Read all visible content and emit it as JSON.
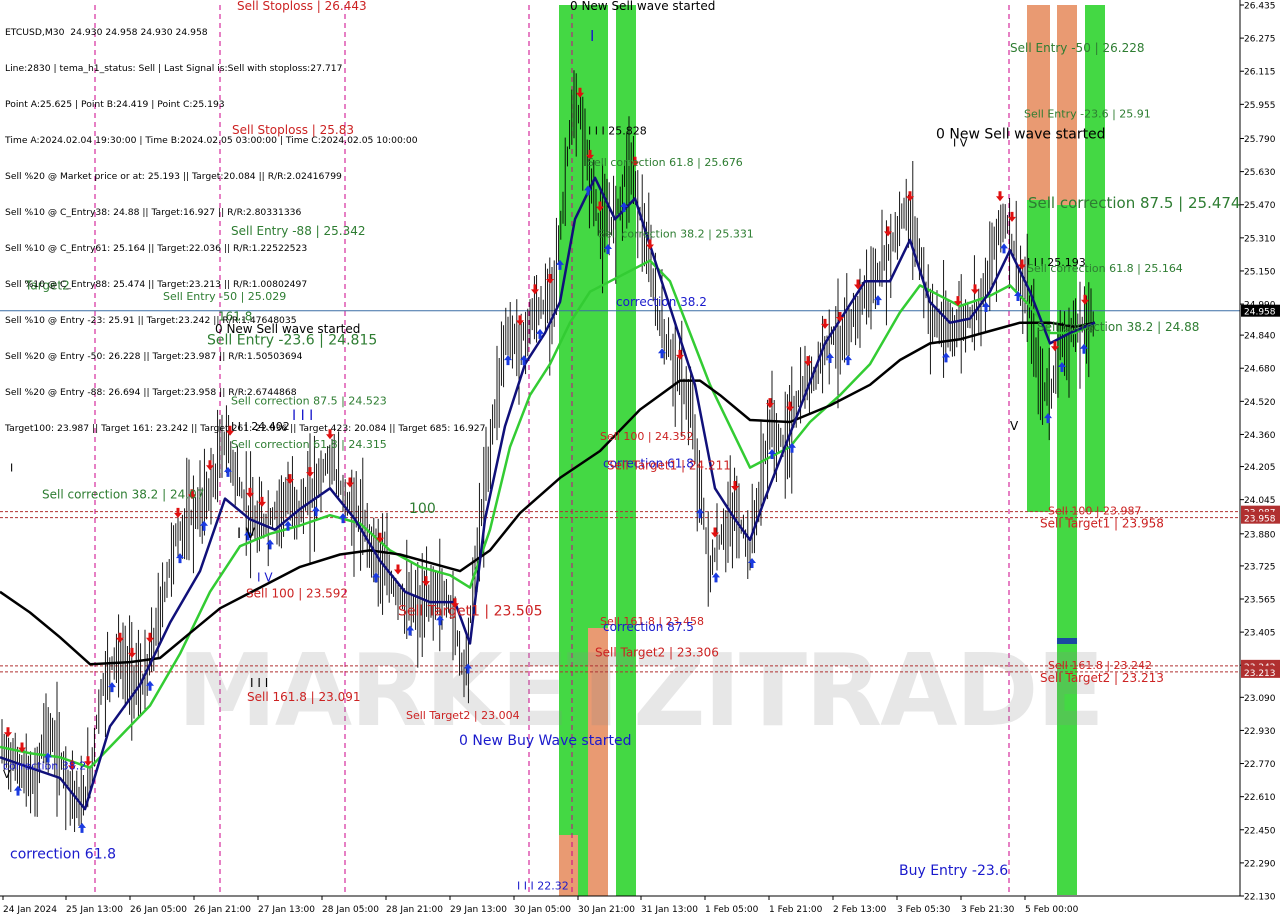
{
  "header": {
    "symbol_line": "ETCUSD,M30  24.930 24.958 24.930 24.958",
    "lines": [
      "Line:2830 | tema_h1_status: Sell | Last Signal is:Sell with stoploss:27.717",
      "Point A:25.625 | Point B:24.419 | Point C:25.193",
      "Time A:2024.02.04 19:30:00 | Time B:2024.02.05 03:00:00 | Time C:2024.02.05 10:00:00",
      "Sell %20 @ Market price or at: 25.193 || Target:20.084 || R/R:2.02416799",
      "Sell %10 @ C_Entry38: 24.88 || Target:16.927 || R/R:2.80331336",
      "Sell %10 @ C_Entry61: 25.164 || Target:22.036 || R/R:1.22522523",
      "Sell %10 @ C_Entry88: 25.474 || Target:23.213 || R/R:1.00802497",
      "Sell %10 @ Entry -23: 25.91 || Target:23.242 || R/R:1.47648035",
      "Sell %20 @ Entry -50: 26.228 || Target:23.987 || R/R:1.50503694",
      "Sell %20 @ Entry -88: 26.694 || Target:23.958 || R/R:2.6744868",
      "Target100: 23.987 || Target 161: 23.242 || Target 261: 22.036 || Target 423: 20.084 || Target 685: 16.927"
    ]
  },
  "colors": {
    "red": "#cc2222",
    "green_text": "#2e7d32",
    "blue_text": "#1a1acc",
    "zone_green": "#3ad63a",
    "zone_orange": "#e8956a",
    "ma_green": "#33cc33",
    "ma_navy": "#10107a",
    "ma_black": "#000000",
    "hline": "#3b6ea5",
    "red_dash": "#b03030",
    "magenta_dash": "#cc0088"
  },
  "chart_data": {
    "type": "candlestick",
    "symbol": "ETCUSD",
    "timeframe": "M30",
    "ylim": [
      22.13,
      26.435
    ],
    "current_price": 24.958,
    "y_ticks": [
      "26.435",
      "26.275",
      "26.115",
      "25.955",
      "25.790",
      "25.630",
      "25.470",
      "25.310",
      "25.150",
      "24.990",
      "24.840",
      "24.680",
      "24.520",
      "24.360",
      "24.205",
      "24.045",
      "23.880",
      "23.725",
      "23.565",
      "23.405",
      "23.245",
      "23.090",
      "22.930",
      "22.770",
      "22.610",
      "22.450",
      "22.290",
      "22.130"
    ],
    "x_labels": [
      "24 Jan 2024",
      "25 Jan 13:00",
      "26 Jan 05:00",
      "26 Jan 21:00",
      "27 Jan 13:00",
      "28 Jan 05:00",
      "28 Jan 21:00",
      "29 Jan 13:00",
      "30 Jan 05:00",
      "30 Jan 21:00",
      "31 Jan 13:00",
      "1 Feb 05:00",
      "1 Feb 21:00",
      "2 Feb 13:00",
      "3 Feb 05:30",
      "3 Feb 21:30",
      "5 Feb 00:00"
    ],
    "price_path": [
      [
        0,
        22.85
      ],
      [
        20,
        22.75
      ],
      [
        35,
        22.65
      ],
      [
        45,
        22.95
      ],
      [
        60,
        22.8
      ],
      [
        80,
        22.55
      ],
      [
        90,
        22.7
      ],
      [
        100,
        23.1
      ],
      [
        115,
        23.3
      ],
      [
        130,
        23.2
      ],
      [
        145,
        23.15
      ],
      [
        160,
        23.5
      ],
      [
        175,
        23.85
      ],
      [
        190,
        23.95
      ],
      [
        200,
        24.0
      ],
      [
        215,
        24.15
      ],
      [
        225,
        24.35
      ],
      [
        240,
        24.1
      ],
      [
        255,
        23.9
      ],
      [
        270,
        23.95
      ],
      [
        285,
        24.05
      ],
      [
        300,
        24.0
      ],
      [
        315,
        24.1
      ],
      [
        330,
        24.25
      ],
      [
        345,
        24.05
      ],
      [
        360,
        23.95
      ],
      [
        375,
        23.8
      ],
      [
        390,
        23.65
      ],
      [
        405,
        23.55
      ],
      [
        420,
        23.5
      ],
      [
        435,
        23.6
      ],
      [
        450,
        23.55
      ],
      [
        465,
        23.2
      ],
      [
        475,
        23.7
      ],
      [
        490,
        24.3
      ],
      [
        505,
        24.85
      ],
      [
        520,
        24.8
      ],
      [
        535,
        24.95
      ],
      [
        550,
        25.0
      ],
      [
        560,
        25.3
      ],
      [
        570,
        25.85
      ],
      [
        580,
        25.9
      ],
      [
        590,
        25.6
      ],
      [
        600,
        25.35
      ],
      [
        615,
        25.4
      ],
      [
        630,
        25.7
      ],
      [
        645,
        25.3
      ],
      [
        660,
        24.9
      ],
      [
        675,
        24.7
      ],
      [
        690,
        24.5
      ],
      [
        700,
        24.1
      ],
      [
        710,
        23.7
      ],
      [
        720,
        23.85
      ],
      [
        735,
        24.0
      ],
      [
        750,
        23.8
      ],
      [
        760,
        24.1
      ],
      [
        770,
        24.4
      ],
      [
        785,
        24.3
      ],
      [
        800,
        24.55
      ],
      [
        815,
        24.65
      ],
      [
        830,
        24.85
      ],
      [
        845,
        24.8
      ],
      [
        860,
        25.0
      ],
      [
        875,
        25.1
      ],
      [
        890,
        25.25
      ],
      [
        905,
        25.45
      ],
      [
        915,
        25.35
      ],
      [
        930,
        24.95
      ],
      [
        945,
        24.85
      ],
      [
        960,
        24.9
      ],
      [
        975,
        24.95
      ],
      [
        990,
        25.15
      ],
      [
        1000,
        25.4
      ],
      [
        1010,
        25.35
      ],
      [
        1020,
        25.1
      ],
      [
        1030,
        24.95
      ],
      [
        1040,
        24.6
      ],
      [
        1050,
        24.55
      ],
      [
        1060,
        24.8
      ],
      [
        1075,
        24.85
      ],
      [
        1085,
        24.9
      ],
      [
        1095,
        24.93
      ]
    ],
    "ma_black": [
      [
        0,
        23.6
      ],
      [
        30,
        23.5
      ],
      [
        60,
        23.38
      ],
      [
        90,
        23.25
      ],
      [
        130,
        23.26
      ],
      [
        160,
        23.28
      ],
      [
        190,
        23.4
      ],
      [
        220,
        23.52
      ],
      [
        260,
        23.62
      ],
      [
        300,
        23.72
      ],
      [
        340,
        23.78
      ],
      [
        370,
        23.8
      ],
      [
        400,
        23.78
      ],
      [
        430,
        23.74
      ],
      [
        460,
        23.7
      ],
      [
        490,
        23.8
      ],
      [
        520,
        23.98
      ],
      [
        560,
        24.15
      ],
      [
        600,
        24.28
      ],
      [
        640,
        24.48
      ],
      [
        680,
        24.62
      ],
      [
        700,
        24.62
      ],
      [
        720,
        24.55
      ],
      [
        750,
        24.43
      ],
      [
        790,
        24.42
      ],
      [
        830,
        24.5
      ],
      [
        870,
        24.6
      ],
      [
        900,
        24.72
      ],
      [
        930,
        24.8
      ],
      [
        960,
        24.82
      ],
      [
        990,
        24.86
      ],
      [
        1020,
        24.9
      ],
      [
        1050,
        24.9
      ],
      [
        1075,
        24.88
      ],
      [
        1095,
        24.9
      ]
    ],
    "ma_green": [
      [
        0,
        22.85
      ],
      [
        30,
        22.82
      ],
      [
        60,
        22.8
      ],
      [
        90,
        22.75
      ],
      [
        120,
        22.9
      ],
      [
        150,
        23.05
      ],
      [
        180,
        23.3
      ],
      [
        210,
        23.6
      ],
      [
        240,
        23.82
      ],
      [
        270,
        23.88
      ],
      [
        300,
        23.92
      ],
      [
        330,
        23.97
      ],
      [
        360,
        23.93
      ],
      [
        390,
        23.8
      ],
      [
        420,
        23.72
      ],
      [
        450,
        23.68
      ],
      [
        470,
        23.62
      ],
      [
        490,
        23.9
      ],
      [
        510,
        24.3
      ],
      [
        530,
        24.55
      ],
      [
        550,
        24.7
      ],
      [
        570,
        24.9
      ],
      [
        590,
        25.05
      ],
      [
        610,
        25.1
      ],
      [
        630,
        25.15
      ],
      [
        650,
        25.2
      ],
      [
        670,
        25.1
      ],
      [
        690,
        24.85
      ],
      [
        710,
        24.6
      ],
      [
        730,
        24.4
      ],
      [
        750,
        24.2
      ],
      [
        770,
        24.25
      ],
      [
        790,
        24.3
      ],
      [
        810,
        24.42
      ],
      [
        840,
        24.55
      ],
      [
        870,
        24.7
      ],
      [
        900,
        24.95
      ],
      [
        920,
        25.08
      ],
      [
        940,
        25.03
      ],
      [
        960,
        24.98
      ],
      [
        990,
        25.03
      ],
      [
        1010,
        25.08
      ],
      [
        1030,
        24.98
      ],
      [
        1050,
        24.85
      ],
      [
        1075,
        24.85
      ],
      [
        1095,
        24.9
      ]
    ],
    "ma_navy": [
      [
        0,
        22.8
      ],
      [
        30,
        22.75
      ],
      [
        60,
        22.7
      ],
      [
        85,
        22.55
      ],
      [
        110,
        22.95
      ],
      [
        140,
        23.15
      ],
      [
        170,
        23.45
      ],
      [
        200,
        23.7
      ],
      [
        225,
        24.05
      ],
      [
        250,
        23.95
      ],
      [
        275,
        23.9
      ],
      [
        300,
        24.0
      ],
      [
        330,
        24.1
      ],
      [
        355,
        23.95
      ],
      [
        380,
        23.75
      ],
      [
        405,
        23.6
      ],
      [
        430,
        23.55
      ],
      [
        455,
        23.55
      ],
      [
        470,
        23.35
      ],
      [
        485,
        23.95
      ],
      [
        505,
        24.4
      ],
      [
        525,
        24.7
      ],
      [
        545,
        24.85
      ],
      [
        560,
        25.0
      ],
      [
        575,
        25.4
      ],
      [
        595,
        25.6
      ],
      [
        615,
        25.4
      ],
      [
        635,
        25.5
      ],
      [
        655,
        25.2
      ],
      [
        675,
        24.9
      ],
      [
        695,
        24.6
      ],
      [
        715,
        24.1
      ],
      [
        735,
        23.95
      ],
      [
        750,
        23.85
      ],
      [
        765,
        24.05
      ],
      [
        785,
        24.3
      ],
      [
        805,
        24.55
      ],
      [
        825,
        24.8
      ],
      [
        845,
        24.95
      ],
      [
        865,
        25.1
      ],
      [
        890,
        25.1
      ],
      [
        910,
        25.3
      ],
      [
        930,
        25.0
      ],
      [
        950,
        24.9
      ],
      [
        970,
        24.92
      ],
      [
        990,
        25.05
      ],
      [
        1010,
        25.25
      ],
      [
        1030,
        25.05
      ],
      [
        1050,
        24.8
      ],
      [
        1070,
        24.85
      ],
      [
        1095,
        24.9
      ]
    ],
    "levels": [
      {
        "label": "Sell 100 | 23.987",
        "price": 23.987
      },
      {
        "label": "Sell Target1 | 23.958",
        "price": 23.958
      },
      {
        "label": "Sell 161.8 | 23.242",
        "price": 23.242
      },
      {
        "label": "Sell Target2 | 23.213",
        "price": 23.213
      }
    ],
    "annotations": [
      {
        "text": "Sell Stoploss | 26.443",
        "price": 26.443,
        "color": "red"
      },
      {
        "text": "Sell Stoploss | 25.83",
        "price": 25.83,
        "color": "red"
      },
      {
        "text": "Sell Entry -88 | 25.342",
        "price": 25.342,
        "color": "green"
      },
      {
        "text": "Target2",
        "price": 25.08,
        "color": "green"
      },
      {
        "text": "161.8",
        "price": 24.93,
        "color": "green"
      },
      {
        "text": "Sell Entry -50 | 25.029",
        "price": 25.029,
        "color": "green"
      },
      {
        "text": "0 New Sell wave started",
        "price": 24.87,
        "color": "black"
      },
      {
        "text": "Sell Entry -23.6 | 24.815",
        "price": 24.815,
        "color": "green"
      },
      {
        "text": "I I I",
        "price": 24.45,
        "color": "blue"
      },
      {
        "text": "I I I 24.402",
        "price": 24.402,
        "color": "black"
      },
      {
        "text": "Sell correction 87.5 | 24.523",
        "price": 24.523,
        "color": "green"
      },
      {
        "text": "Sell correction 61.8 | 24.315",
        "price": 24.315,
        "color": "green"
      },
      {
        "text": "Sell correction 38.2 | 24.07",
        "price": 24.07,
        "color": "green"
      },
      {
        "text": "100",
        "price": 24.0,
        "color": "green"
      },
      {
        "text": "I V",
        "price": 23.88,
        "color": "black"
      },
      {
        "text": "I V",
        "price": 23.67,
        "color": "blue"
      },
      {
        "text": "Sell 100 | 23.592",
        "price": 23.592,
        "color": "red"
      },
      {
        "text": "Sell Target1 | 23.505",
        "price": 23.505,
        "color": "red"
      },
      {
        "text": "I I I",
        "price": 23.16,
        "color": "black"
      },
      {
        "text": "Sell 161.8 | 23.091",
        "price": 23.091,
        "color": "red"
      },
      {
        "text": "Sell Target2 | 23.004",
        "price": 23.004,
        "color": "red"
      },
      {
        "text": "0 New Buy Wave started",
        "price": 22.88,
        "color": "blue"
      },
      {
        "text": "V",
        "price": 22.72,
        "color": "black"
      },
      {
        "text": "correction 38.2",
        "price": 22.76,
        "color": "blue"
      },
      {
        "text": "correction 61.8",
        "price": 22.33,
        "color": "blue"
      },
      {
        "text": "I I I 22.32",
        "price": 22.18,
        "color": "blue"
      },
      {
        "text": "0 New Sell wave started",
        "price": 26.435,
        "color": "black"
      },
      {
        "text": "I",
        "price": 26.28,
        "color": "blue"
      },
      {
        "text": "I I I 25.828",
        "price": 25.828,
        "color": "black"
      },
      {
        "text": "Sell correction 61.8 | 25.676",
        "price": 25.676,
        "color": "green"
      },
      {
        "text": "Sell correction 38.2 | 25.331",
        "price": 25.331,
        "color": "green"
      },
      {
        "text": "correction 38.2",
        "price": 25.0,
        "color": "blue"
      },
      {
        "text": "Sell 100 | 24.352",
        "price": 24.352,
        "color": "red"
      },
      {
        "text": "correction 61.8",
        "price": 24.22,
        "color": "blue"
      },
      {
        "text": "Sell Target1 | 24.211",
        "price": 24.211,
        "color": "red"
      },
      {
        "text": "Sell 161.8 | 23.458",
        "price": 23.458,
        "color": "red"
      },
      {
        "text": "correction 87.5",
        "price": 23.43,
        "color": "blue"
      },
      {
        "text": "Sell Target2 | 23.306",
        "price": 23.306,
        "color": "red"
      },
      {
        "text": "Buy Entry -23.6",
        "price": 22.25,
        "color": "blue"
      },
      {
        "text": "I V",
        "price": 25.77,
        "color": "black"
      },
      {
        "text": "0 New Sell wave started",
        "price": 25.81,
        "color": "black"
      },
      {
        "text": "V",
        "price": 24.4,
        "color": "black"
      },
      {
        "text": "Sell Entry -50 | 26.228",
        "price": 26.228,
        "color": "green"
      },
      {
        "text": "Sell Entry -23.6 | 25.91",
        "price": 25.91,
        "color": "green"
      },
      {
        "text": "Sell correction 87.5 | 25.474",
        "price": 25.474,
        "color": "green"
      },
      {
        "text": "I I I 25.193",
        "price": 25.193,
        "color": "black"
      },
      {
        "text": "Sell correction 61.8 | 25.164",
        "price": 25.164,
        "color": "green"
      },
      {
        "text": "Sell correction 38.2 | 24.88",
        "price": 24.88,
        "color": "green"
      },
      {
        "text": "I",
        "price": 24.2,
        "color": "black"
      }
    ]
  }
}
